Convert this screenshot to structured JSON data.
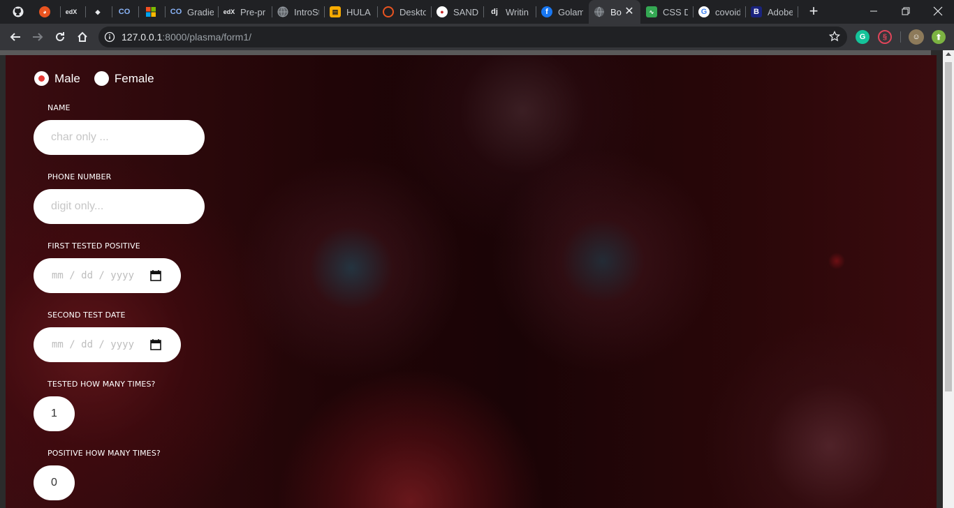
{
  "browser": {
    "tabs": [
      {
        "title": "",
        "icon": "github-icon",
        "color": "#e8eaed"
      },
      {
        "title": "",
        "icon": "ubuntu-icon",
        "color": "#e95420"
      },
      {
        "title": "",
        "icon": "edx-icon",
        "color": "#e8eaed"
      },
      {
        "title": "",
        "icon": "hula-icon",
        "color": "#e8eaed"
      },
      {
        "title": "",
        "icon": "colab-icon",
        "color": "#8ab4f8"
      },
      {
        "title": "",
        "icon": "microsoft-icon",
        "color": "#f25022"
      },
      {
        "title": "Gradie",
        "icon": "colab-icon",
        "color": "#8ab4f8"
      },
      {
        "title": "Pre-pr",
        "icon": "edx-icon",
        "color": "#e8eaed"
      },
      {
        "title": "IntroSt",
        "icon": "globe-icon",
        "color": "#9aa0a6"
      },
      {
        "title": "HULA",
        "icon": "book-icon",
        "color": "#f9ab00"
      },
      {
        "title": "Deskto",
        "icon": "ubuntu-icon",
        "color": "#e95420"
      },
      {
        "title": "SANDI",
        "icon": "sandi-icon",
        "color": "#c62828"
      },
      {
        "title": "Writin",
        "icon": "django-icon",
        "color": "#e8eaed"
      },
      {
        "title": "Golam",
        "icon": "facebook-icon",
        "color": "#1877f2"
      },
      {
        "title": "Bo",
        "icon": "globe-icon",
        "color": "#9aa0a6",
        "active": true
      },
      {
        "title": "CSS Di",
        "icon": "css-icon",
        "color": "#34a853"
      },
      {
        "title": "covoid",
        "icon": "google-icon",
        "color": "#ea4335"
      },
      {
        "title": "Adobe",
        "icon": "adobe-b-icon",
        "color": "#1a237e"
      }
    ],
    "url_host": "127.0.0.1",
    "url_path": ":8000/plasma/form1/"
  },
  "form": {
    "gender_options": [
      "Male",
      "Female"
    ],
    "gender_selected": "Male",
    "name_label": "NAME",
    "name_placeholder": "char only ...",
    "phone_label": "PHONE NUMBER",
    "phone_placeholder": "digit only...",
    "first_positive_label": "FIRST TESTED POSITIVE",
    "first_positive_placeholder": "mm / dd / yyyy",
    "second_test_label": "SECOND TEST DATE",
    "second_test_placeholder": "mm / dd / yyyy",
    "tested_times_label": "TESTED HOW MANY TIMES?",
    "tested_times_value": "1",
    "positive_times_label": "POSITIVE HOW MANY TIMES?",
    "positive_times_value": "0"
  },
  "colors": {
    "radio_checked": "#e53935",
    "page_background": "#200507"
  }
}
